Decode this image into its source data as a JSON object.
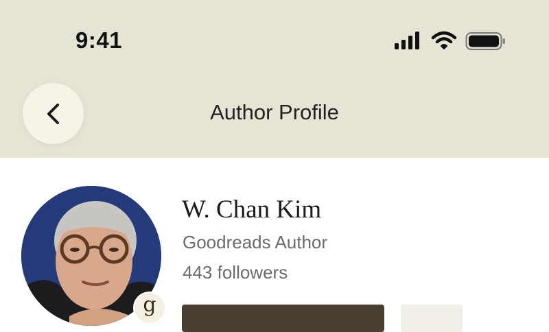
{
  "status_bar": {
    "time": "9:41",
    "icons": [
      "cellular-signal-icon",
      "wifi-icon",
      "battery-icon"
    ]
  },
  "header": {
    "title": "Author Profile",
    "back_icon": "chevron-left-icon"
  },
  "author": {
    "name": "W. Chan Kim",
    "role": "Goodreads Author",
    "followers": "443 followers",
    "badge_letter": "g"
  },
  "colors": {
    "header_bg": "#e6e4d4",
    "back_button_bg": "#f6f4e9",
    "primary_button": "#4a3e32",
    "secondary_text": "#6b6b6b"
  }
}
